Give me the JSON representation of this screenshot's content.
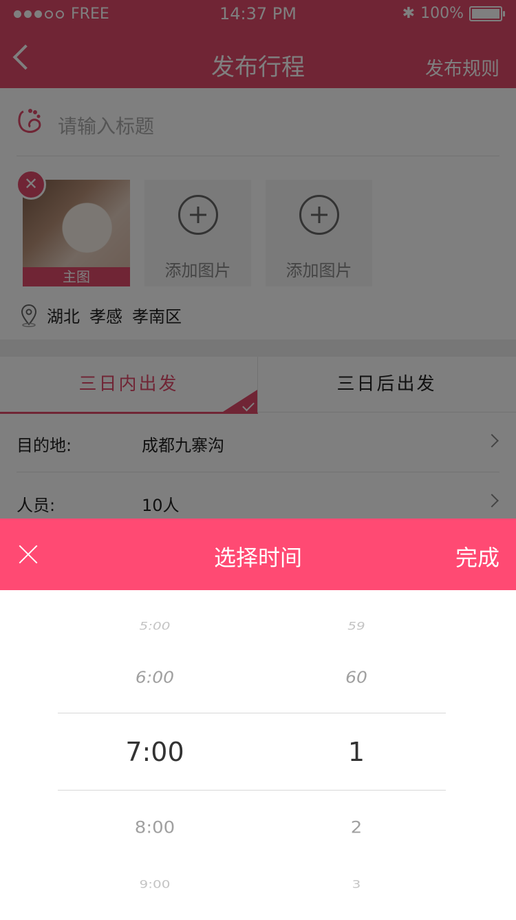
{
  "status_bar": {
    "carrier": "FREE",
    "time": "14:37 PM",
    "battery": "100%"
  },
  "nav": {
    "back_icon": "chevron-left-icon",
    "title": "发布行程",
    "rules": "发布规则"
  },
  "form": {
    "title_placeholder": "请输入标题",
    "photos": {
      "main_label": "主图",
      "add_label_1": "添加图片",
      "add_label_2": "添加图片"
    },
    "location": {
      "province": "湖北",
      "city": "孝感",
      "district": "孝南区"
    },
    "tabs": {
      "left": "三日内出发",
      "right": "三日后出发",
      "selected": "left"
    },
    "destination": {
      "label": "目的地:",
      "value": "成都九寨沟"
    },
    "people": {
      "label": "人员:",
      "value": "10人"
    }
  },
  "picker": {
    "title": "选择时间",
    "done": "完成",
    "hours": [
      "5:00",
      "6:00",
      "7:00",
      "8:00",
      "9:00"
    ],
    "minutes": [
      "59",
      "60",
      "1",
      "2",
      "3"
    ],
    "selected_hour": "7:00",
    "selected_minute": "1"
  },
  "colors": {
    "accent": "#ff4a73",
    "accent_dim": "#e14a6b"
  }
}
